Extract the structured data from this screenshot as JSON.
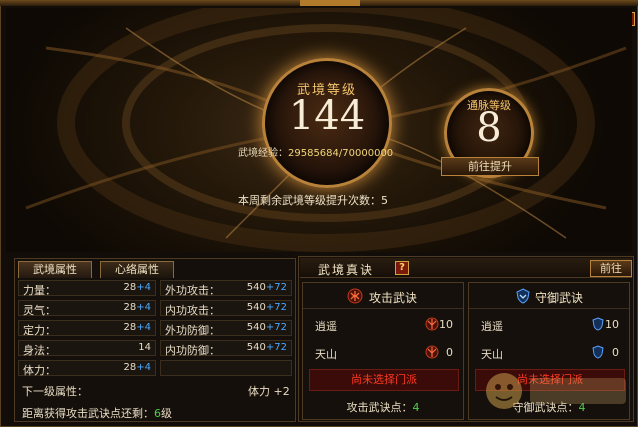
{
  "header": {
    "help_label": "?"
  },
  "realm": {
    "level_label": "武境等级",
    "level_value": "144",
    "meridian_label": "通脉等级",
    "meridian_value": "8",
    "exp_label": "武境经验：",
    "exp_value": "29585684/70000000",
    "goto_upgrade_label": "前往提升",
    "weekly_text": "本周剩余武境等级提升次数：5"
  },
  "left_panel": {
    "tabs": [
      {
        "label": "武境属性"
      },
      {
        "label": "心络属性"
      }
    ],
    "stats_left": [
      {
        "name": "力量：",
        "base": "28",
        "bonus": "+4"
      },
      {
        "name": "灵气：",
        "base": "28",
        "bonus": "+4"
      },
      {
        "name": "定力：",
        "base": "28",
        "bonus": "+4"
      },
      {
        "name": "身法：",
        "base": "14",
        "bonus": ""
      },
      {
        "name": "体力：",
        "base": "28",
        "bonus": "+4"
      }
    ],
    "stats_right": [
      {
        "name": "外功攻击：",
        "base": "540",
        "bonus": "+72"
      },
      {
        "name": "内功攻击：",
        "base": "540",
        "bonus": "+72"
      },
      {
        "name": "外功防御：",
        "base": "540",
        "bonus": "+72"
      },
      {
        "name": "内功防御：",
        "base": "540",
        "bonus": "+72"
      }
    ],
    "next_level_label": "下一级属性：",
    "next_level_value": "体力 +2",
    "distance_prefix": "距离获得攻击武诀点还剩：",
    "distance_value": "6",
    "distance_suffix": "级"
  },
  "right_panel": {
    "title": "武境真诀",
    "help_label": "?",
    "goto_label": "前往",
    "attack": {
      "title": "攻击武诀",
      "items": [
        {
          "name": "逍遥",
          "count": "10"
        },
        {
          "name": "天山",
          "count": "0"
        }
      ],
      "warning": "尚未选择门派",
      "points_label": "攻击武诀点：",
      "points_value": "4"
    },
    "defense": {
      "title": "守御武诀",
      "items": [
        {
          "name": "逍遥",
          "count": "10"
        },
        {
          "name": "天山",
          "count": "0"
        }
      ],
      "warning": "尚未选择门派",
      "points_label": "守御武诀点：",
      "points_value": "4"
    }
  },
  "colors": {
    "gold": "#f3c46a",
    "bonus": "#4aa8ff",
    "warning": "#ff3a22",
    "green": "#4cd04c"
  }
}
